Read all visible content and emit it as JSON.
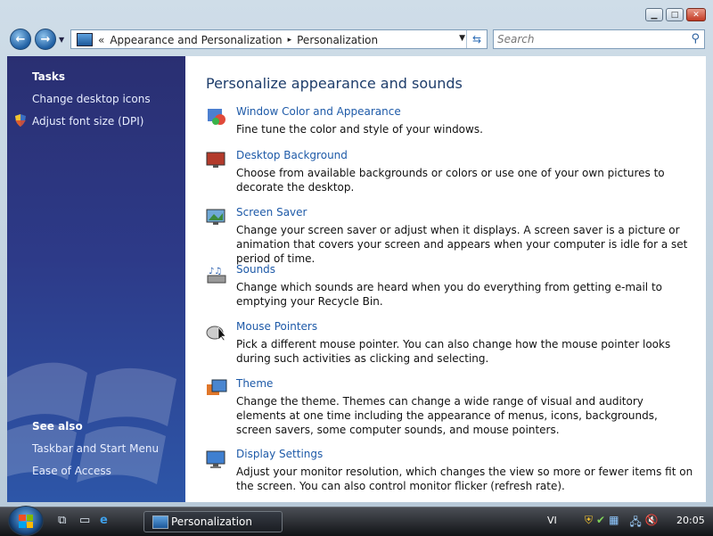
{
  "navbar": {
    "back_glyph": "←",
    "forward_glyph": "→",
    "address": {
      "lead": "«",
      "crumbs": [
        "Appearance and Personalization",
        "Personalization"
      ],
      "separator": "▸"
    },
    "search_placeholder": "Search"
  },
  "sidebar": {
    "tasks_heading": "Tasks",
    "tasks": [
      "Change desktop icons",
      "Adjust font size (DPI)"
    ],
    "see_also_heading": "See also",
    "see_also": [
      "Taskbar and Start Menu",
      "Ease of Access"
    ]
  },
  "content": {
    "title": "Personalize appearance and sounds",
    "items": [
      {
        "link": "Window Color and Appearance",
        "desc": "Fine tune the color and style of your windows.",
        "icon": "window-color-icon"
      },
      {
        "link": "Desktop Background",
        "desc": "Choose from available backgrounds or colors or use one of your own pictures to decorate the desktop.",
        "icon": "desktop-background-icon"
      },
      {
        "link": "Screen Saver",
        "desc": "Change your screen saver or adjust when it displays. A screen saver is a picture or animation that covers your screen and appears when your computer is idle for a set period of time.",
        "icon": "screen-saver-icon"
      },
      {
        "link": "Sounds",
        "desc": "Change which sounds are heard when you do everything from getting e-mail to emptying your Recycle Bin.",
        "icon": "sounds-icon"
      },
      {
        "link": "Mouse Pointers",
        "desc": "Pick a different mouse pointer. You can also change how the mouse pointer looks during such activities as clicking and selecting.",
        "icon": "mouse-pointers-icon"
      },
      {
        "link": "Theme",
        "desc": "Change the theme. Themes can change a wide range of visual and auditory elements at one time including the appearance of menus, icons, backgrounds, screen savers, some computer sounds, and mouse pointers.",
        "icon": "theme-icon"
      },
      {
        "link": "Display Settings",
        "desc": "Adjust your monitor resolution, which changes the view so more or fewer items fit on the screen. You can also control monitor flicker (refresh rate).",
        "icon": "display-settings-icon"
      }
    ]
  },
  "taskbar": {
    "window_label": "Personalization",
    "language": "VI",
    "clock": "20:05"
  },
  "colors": {
    "link": "#1e5aa8",
    "sidebar_top": "#2a2f72",
    "sidebar_bottom": "#2d56a8"
  }
}
